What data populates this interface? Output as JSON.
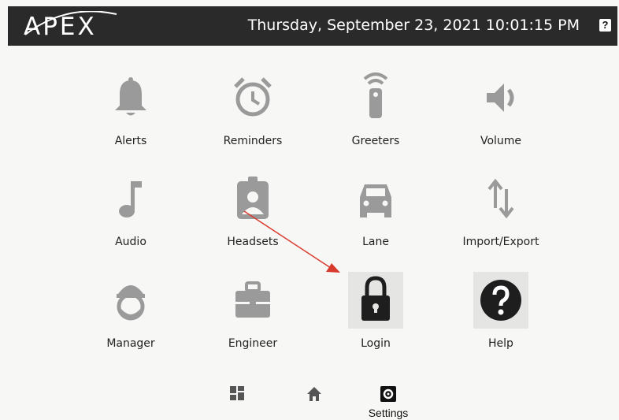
{
  "header": {
    "logo_text": "APEX",
    "datetime": "Thursday, September 23, 2021 10:01:15 PM",
    "help_label": "?"
  },
  "tiles": [
    {
      "label": "Alerts"
    },
    {
      "label": "Reminders"
    },
    {
      "label": "Greeters"
    },
    {
      "label": "Volume"
    },
    {
      "label": "Audio"
    },
    {
      "label": "Headsets"
    },
    {
      "label": "Lane"
    },
    {
      "label": "Import/Export"
    },
    {
      "label": "Manager"
    },
    {
      "label": "Engineer"
    },
    {
      "label": "Login"
    },
    {
      "label": "Help"
    }
  ],
  "nav": {
    "settings_label": "Settings"
  },
  "colors": {
    "icon_gray": "#9a9a9a",
    "icon_dark": "#1e1e1e",
    "highlight": "#e5e5e3",
    "topbar": "#2a2a2a",
    "annotation": "#d93a2e"
  }
}
